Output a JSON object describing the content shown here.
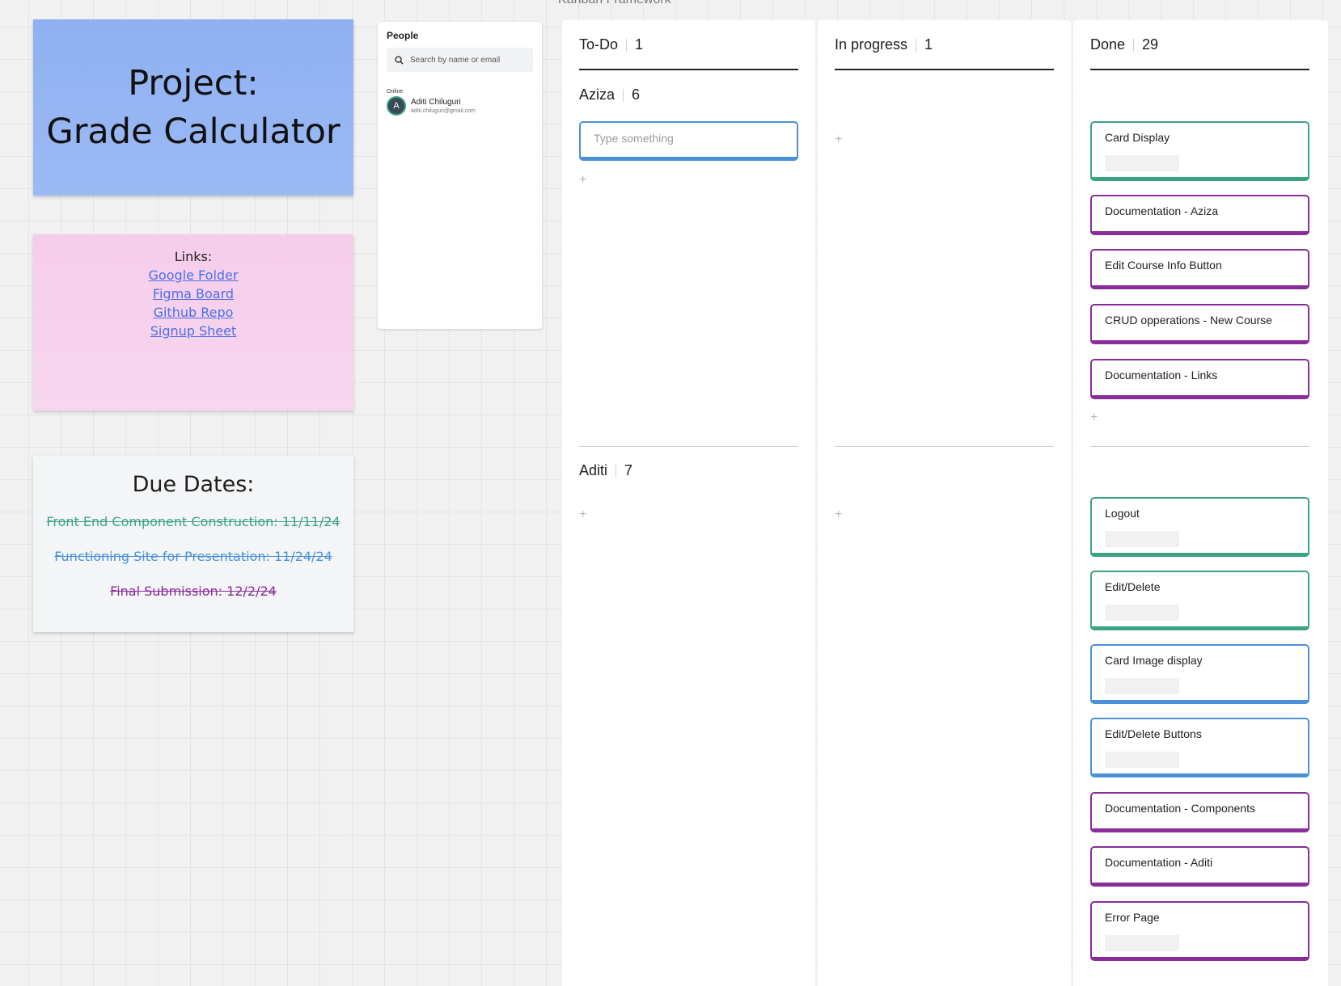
{
  "title_note": {
    "line1": "Project:",
    "line2": "Grade Calculator"
  },
  "links_note": {
    "header": "Links:",
    "links": [
      "Google Folder",
      "Figma Board",
      "Github Repo",
      "Signup Sheet"
    ]
  },
  "dates_note": {
    "header": "Due Dates:",
    "items": [
      "Front End Component Construction: 11/11/24",
      "Functioning Site for Presentation: 11/24/24",
      "Final Submission: 12/2/24"
    ]
  },
  "people": {
    "title": "People",
    "search_placeholder": "Search by name or email",
    "online_label": "Online",
    "user": {
      "initial": "A",
      "name": "Aditi Chiluguri",
      "email": "aditi.chiluguri@gmail.com"
    }
  },
  "kanban": {
    "frame_title": "Kanban Framework",
    "columns": [
      {
        "name": "To-Do",
        "count": "1"
      },
      {
        "name": "In progress",
        "count": "1"
      },
      {
        "name": "Done",
        "count": "29"
      }
    ],
    "lanes": [
      {
        "name": "Aziza",
        "count": "6"
      },
      {
        "name": "Aditi",
        "count": "7"
      }
    ],
    "input_placeholder": "Type something",
    "add_symbol": "+",
    "done_cards": [
      "Card Display",
      "Documentation - Aziza",
      "Edit Course Info Button",
      "CRUD opperations - New Course",
      "Documentation - Links",
      "Logout",
      "Edit/Delete",
      "Card Image display",
      "Edit/Delete Buttons",
      "Documentation - Components",
      "Documentation - Aditi",
      "Error Page"
    ]
  },
  "colors": {
    "green": "#3aa383",
    "purple": "#8a2c9a",
    "blue": "#4a92d8",
    "title_note": "#8fb0f2",
    "links_note": "#f5cdeb"
  }
}
